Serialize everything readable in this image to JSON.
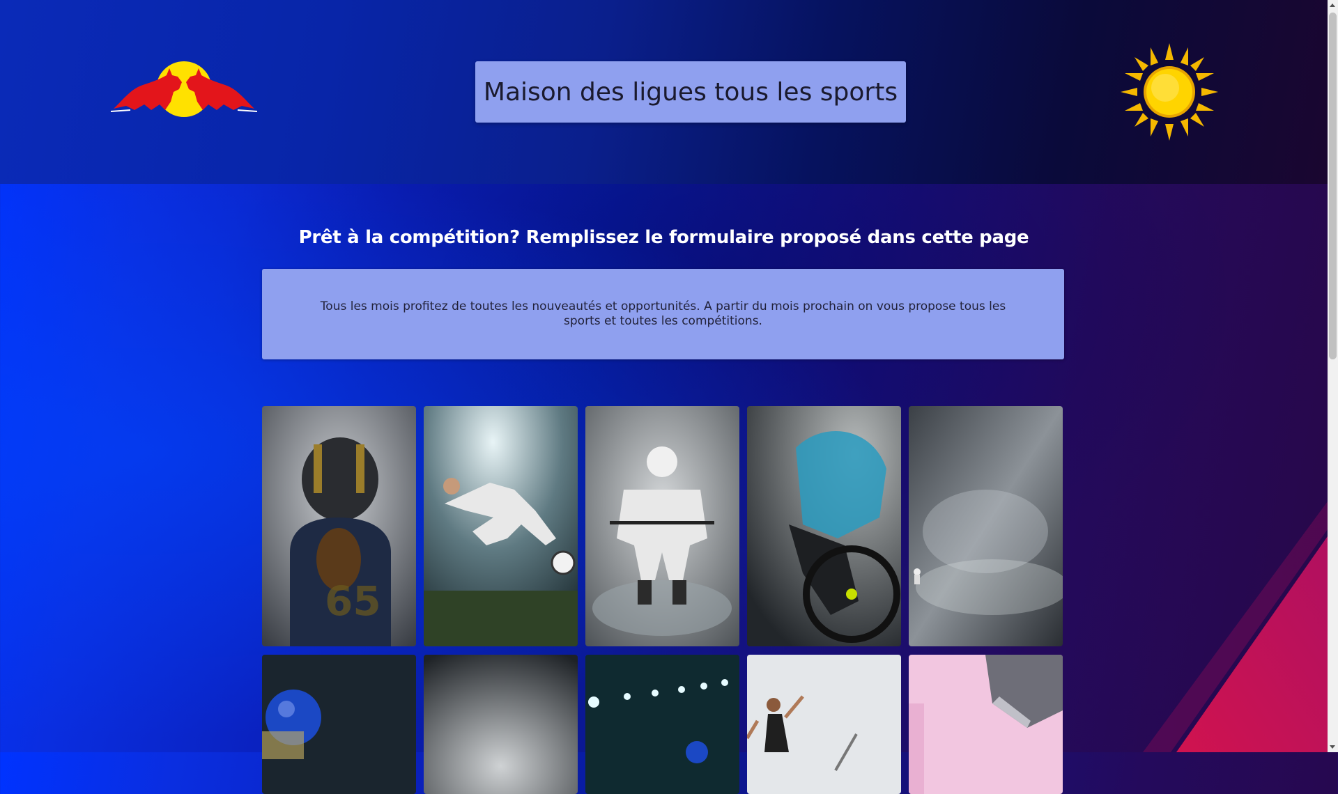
{
  "header": {
    "title": "Maison des ligues tous les sports",
    "logo_icon": "red-bull-logo-icon",
    "weather_icon": "sun-icon"
  },
  "main": {
    "headline": "Prêt à la compétition? Remplissez le formulaire proposé dans cette page",
    "info_text": "Tous les mois profitez de toutes les nouveautés et opportunités. A partir du mois prochain on vous propose tous les sports et toutes les compétitions."
  },
  "gallery": {
    "row1": [
      {
        "name": "american-football-player-image",
        "icon": "football-player"
      },
      {
        "name": "soccer-player-kicking-image",
        "icon": "soccer-player"
      },
      {
        "name": "hockey-player-image",
        "icon": "hockey-player"
      },
      {
        "name": "cyclist-image",
        "icon": "cyclist"
      },
      {
        "name": "skier-storm-image",
        "icon": "skier"
      }
    ],
    "row2": [
      {
        "name": "boxer-blue-gloves-image",
        "icon": "boxer"
      },
      {
        "name": "foggy-stadium-image",
        "icon": "stadium"
      },
      {
        "name": "stadium-lights-image",
        "icon": "stadium-lights"
      },
      {
        "name": "diver-jumping-image",
        "icon": "diver"
      },
      {
        "name": "pink-building-image",
        "icon": "building"
      }
    ]
  },
  "colors": {
    "accent_box": "#8fa0ef",
    "sun": "#ffd400",
    "bull_red": "#e3151b"
  }
}
